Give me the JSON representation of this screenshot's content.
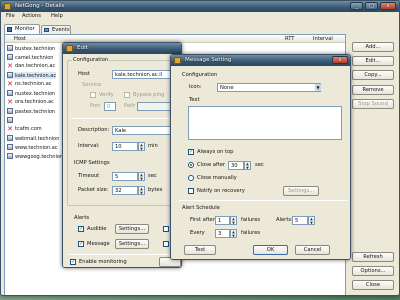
{
  "main": {
    "title": "NetGong - Details",
    "menu": [
      "File",
      "Actions",
      "Help"
    ],
    "tabs": [
      {
        "label": "Monitor"
      },
      {
        "label": "Events"
      }
    ],
    "columns": {
      "host": "Host",
      "rtt": "RTT",
      "interval": "Interval"
    },
    "rows": [
      {
        "host": "bustex.technion",
        "status": "ok"
      },
      {
        "host": "camel.technion",
        "status": "ok"
      },
      {
        "host": "dan.technion.ac",
        "status": "err"
      },
      {
        "host": "kale.technion.ac",
        "status": "ok"
      },
      {
        "host": "ns.technion.ac",
        "status": "err"
      },
      {
        "host": "nustex.technion",
        "status": "ok"
      },
      {
        "host": "ora.technion.ac",
        "status": "err"
      },
      {
        "host": "pastex.technion",
        "status": "ok"
      },
      {
        "host": "",
        "status": "ok"
      },
      {
        "host": "tcafm.com",
        "status": "err"
      },
      {
        "host": "webmail.technion",
        "status": "ok"
      },
      {
        "host": "www.technion.ac",
        "status": "ok"
      },
      {
        "host": "wwwgoog.technion",
        "status": "ok"
      }
    ],
    "buttons": {
      "add": "Add...",
      "edit": "Edit...",
      "copy": "Copy...",
      "remove": "Remove",
      "stop_sound": "Stop Sound",
      "refresh": "Refresh",
      "options": "Options...",
      "close": "Close"
    }
  },
  "edit": {
    "title": "Edit",
    "configuration": "Configuration",
    "host_label": "Host",
    "host_value": "kale.technion.ac.il",
    "service_label": "Service",
    "verify_label": "Verify",
    "bypass_label": "Bypass ping",
    "port_label": "Port",
    "port_value": "0",
    "path_label": "Path",
    "description_label": "Description:",
    "description_value": "Kale",
    "interval_label": "Interval:",
    "interval_value": "10",
    "interval_unit": "min",
    "icmp_title": "ICMP Settings",
    "timeout_label": "Timeout",
    "timeout_value": "5",
    "timeout_unit": "sec",
    "packet_label": "Packet size:",
    "packet_value": "32",
    "packet_unit": "bytes",
    "alerts_title": "Alerts",
    "audible_label": "Audible",
    "message_label": "Message",
    "settings_btn": "Settings...",
    "enable_label": "Enable monitoring"
  },
  "msg": {
    "title": "Message Setting",
    "configuration": "Configuration",
    "icon_label": "Icon:",
    "icon_value": "None",
    "text_label": "Text",
    "always_on_top": "Always on top",
    "close_after": "Close after",
    "close_after_value": "30",
    "close_after_unit": "sec",
    "close_manually": "Close manually",
    "notify_recovery": "Notify on recovery",
    "settings_btn": "Settings...",
    "schedule_title": "Alert Schedule",
    "first_after": "First after",
    "first_after_value": "1",
    "first_after_unit": "failures",
    "alerts_label": "Alerts:",
    "alerts_value": "5",
    "every_label": "Every",
    "every_value": "3",
    "every_unit": "failures",
    "test_btn": "Test",
    "ok_btn": "OK",
    "cancel_btn": "Cancel"
  }
}
